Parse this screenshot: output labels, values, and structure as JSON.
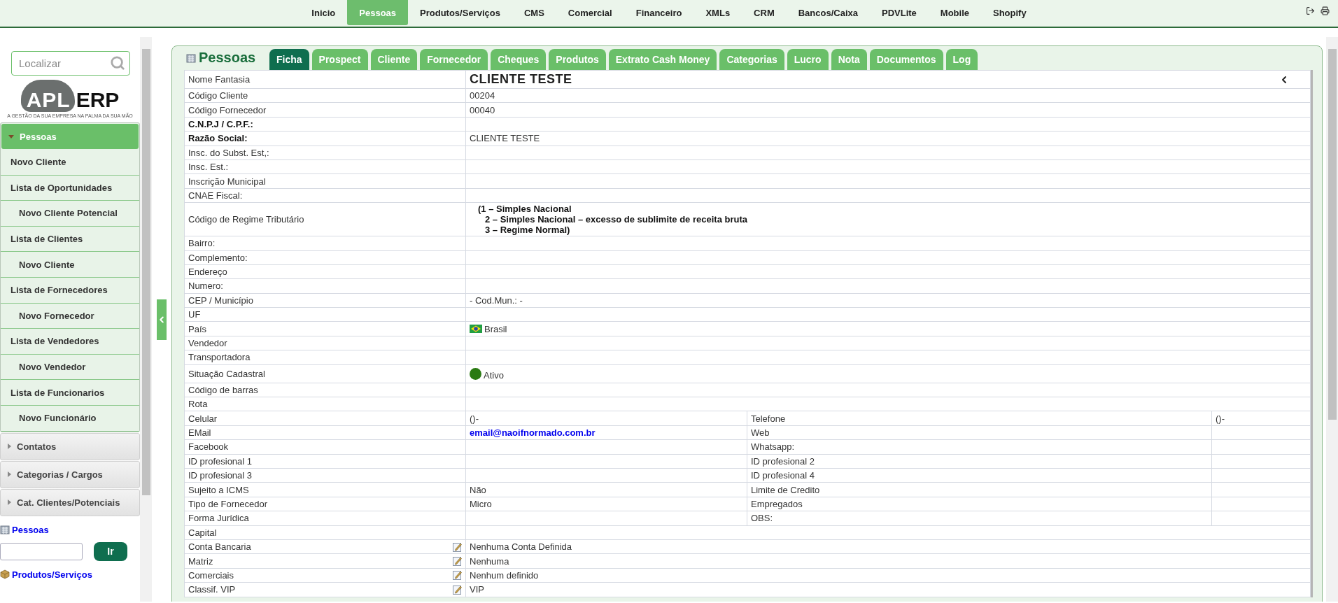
{
  "top_nav": {
    "items": [
      {
        "label": "Inicio",
        "selected": false
      },
      {
        "label": "Pessoas",
        "selected": true
      },
      {
        "label": "Produtos/Serviços",
        "selected": false
      },
      {
        "label": "CMS",
        "selected": false
      },
      {
        "label": "Comercial",
        "selected": false
      },
      {
        "label": "Financeiro",
        "selected": false
      },
      {
        "label": "XMLs",
        "selected": false
      },
      {
        "label": "CRM",
        "selected": false
      },
      {
        "label": "Bancos/Caixa",
        "selected": false
      },
      {
        "label": "PDVLite",
        "selected": false
      },
      {
        "label": "Mobile",
        "selected": false
      },
      {
        "label": "Shopify",
        "selected": false
      }
    ]
  },
  "sidebar": {
    "search": {
      "placeholder": "Localizar"
    },
    "logo": {
      "part_1": "APL",
      "part_2": "ERP",
      "tagline": "A GESTÃO DA SUA EMPRESA NA PALMA DA SUA MÃO"
    },
    "sections": [
      {
        "label": "Pessoas",
        "expanded": true,
        "items": [
          {
            "label": "Novo Cliente"
          },
          {
            "label": "Lista de Oportunidades",
            "children": [
              {
                "label": "Novo Cliente Potencial"
              }
            ]
          },
          {
            "label": "Lista de Clientes",
            "children": [
              {
                "label": "Novo Cliente"
              }
            ]
          },
          {
            "label": "Lista de Fornecedores",
            "children": [
              {
                "label": "Novo Fornecedor"
              }
            ]
          },
          {
            "label": "Lista de Vendedores",
            "children": [
              {
                "label": "Novo Vendedor"
              }
            ]
          },
          {
            "label": "Lista de Funcionarios",
            "children": [
              {
                "label": "Novo Funcionário"
              }
            ]
          }
        ]
      },
      {
        "label": "Contatos",
        "expanded": false
      },
      {
        "label": "Categorias / Cargos",
        "expanded": false
      },
      {
        "label": "Cat. Clientes/Potenciais",
        "expanded": false
      }
    ],
    "quick_links": [
      {
        "kind": "people",
        "label": "Pessoas",
        "button": "Ir"
      },
      {
        "kind": "products",
        "label": "Produtos/Serviços"
      }
    ]
  },
  "panel": {
    "title": "Pessoas",
    "tabs": [
      {
        "label": "Ficha",
        "selected": true
      },
      {
        "label": "Prospect",
        "selected": false
      },
      {
        "label": "Cliente",
        "selected": false
      },
      {
        "label": "Fornecedor",
        "selected": false
      },
      {
        "label": "Cheques",
        "selected": false
      },
      {
        "label": "Produtos",
        "selected": false
      },
      {
        "label": "Extrato Cash Money",
        "selected": false
      },
      {
        "label": "Categorias",
        "selected": false
      },
      {
        "label": "Lucro",
        "selected": false
      },
      {
        "label": "Nota",
        "selected": false
      },
      {
        "label": "Documentos",
        "selected": false
      },
      {
        "label": "Log",
        "selected": false
      }
    ],
    "rows": [
      {
        "kind": "title",
        "label": "Nome Fantasia",
        "value": "CLIENTE TESTE"
      },
      {
        "kind": "field",
        "label": "Código Cliente",
        "value": "00204"
      },
      {
        "kind": "field",
        "label": "Código Fornecedor",
        "value": "00040"
      },
      {
        "kind": "required",
        "label": "C.N.P.J / C.P.F.:"
      },
      {
        "kind": "required",
        "label": "Razão Social:",
        "value": "CLIENTE TESTE"
      },
      {
        "kind": "field",
        "label": "Insc. do Subst. Est,:"
      },
      {
        "kind": "field",
        "label": "Insc. Est.:"
      },
      {
        "kind": "field",
        "label": "Inscrição Municipal"
      },
      {
        "kind": "field",
        "label": "CNAE Fiscal:"
      },
      {
        "kind": "regime",
        "label": "Código de Regime Tributário",
        "lines": [
          "(1 – Simples Nacional",
          "2 – Simples Nacional – excesso de sublimite de receita bruta",
          "3 – Regime Normal)"
        ]
      },
      {
        "kind": "field",
        "label": "Bairro:"
      },
      {
        "kind": "field",
        "label": "Complemento:"
      },
      {
        "kind": "field",
        "label": "Endereço"
      },
      {
        "kind": "field",
        "label": "Numero:"
      },
      {
        "kind": "field",
        "label": "CEP / Município",
        "value": "- Cod.Mun.: -"
      },
      {
        "kind": "field",
        "label": "UF"
      },
      {
        "kind": "flag",
        "label": "País",
        "value": "Brasil"
      },
      {
        "kind": "field",
        "label": "Vendedor"
      },
      {
        "kind": "field",
        "label": "Transportadora"
      },
      {
        "kind": "status",
        "label": "Situação Cadastral",
        "value": "Ativo",
        "color": "#2a7a12"
      },
      {
        "kind": "field",
        "label": "Código de barras"
      },
      {
        "kind": "field",
        "label": "Rota"
      },
      {
        "kind": "pair",
        "label": "Celular",
        "value": "()-",
        "label_2": "Telefone",
        "value_2": "()-"
      },
      {
        "kind": "email_pair",
        "label": "EMail",
        "value": "email@naoifnormado.com.br",
        "label_2": "Web"
      },
      {
        "kind": "pair",
        "label": "Facebook",
        "label_2": "Whatsapp:"
      },
      {
        "kind": "pair",
        "label": "ID profesional 1",
        "label_2": "ID profesional 2"
      },
      {
        "kind": "pair",
        "label": "ID profesional 3",
        "label_2": "ID profesional 4"
      },
      {
        "kind": "pair",
        "label": "Sujeito a ICMS",
        "value": "Não",
        "label_2": "Limite de Credito"
      },
      {
        "kind": "pair",
        "label": "Tipo de Fornecedor",
        "value": "Micro",
        "label_2": "Empregados"
      },
      {
        "kind": "pair",
        "label": "Forma Jurídica",
        "label_2": "OBS:"
      },
      {
        "kind": "field",
        "label": "Capital"
      },
      {
        "kind": "edit",
        "label": "Conta Bancaria",
        "value": "Nenhuma Conta Definida"
      },
      {
        "kind": "edit",
        "label": "Matriz",
        "value": "Nenhuma"
      },
      {
        "kind": "edit",
        "label": "Comerciais",
        "value": "Nenhum definido"
      },
      {
        "kind": "edit",
        "label": "Classif. VIP",
        "value": "VIP"
      }
    ]
  }
}
